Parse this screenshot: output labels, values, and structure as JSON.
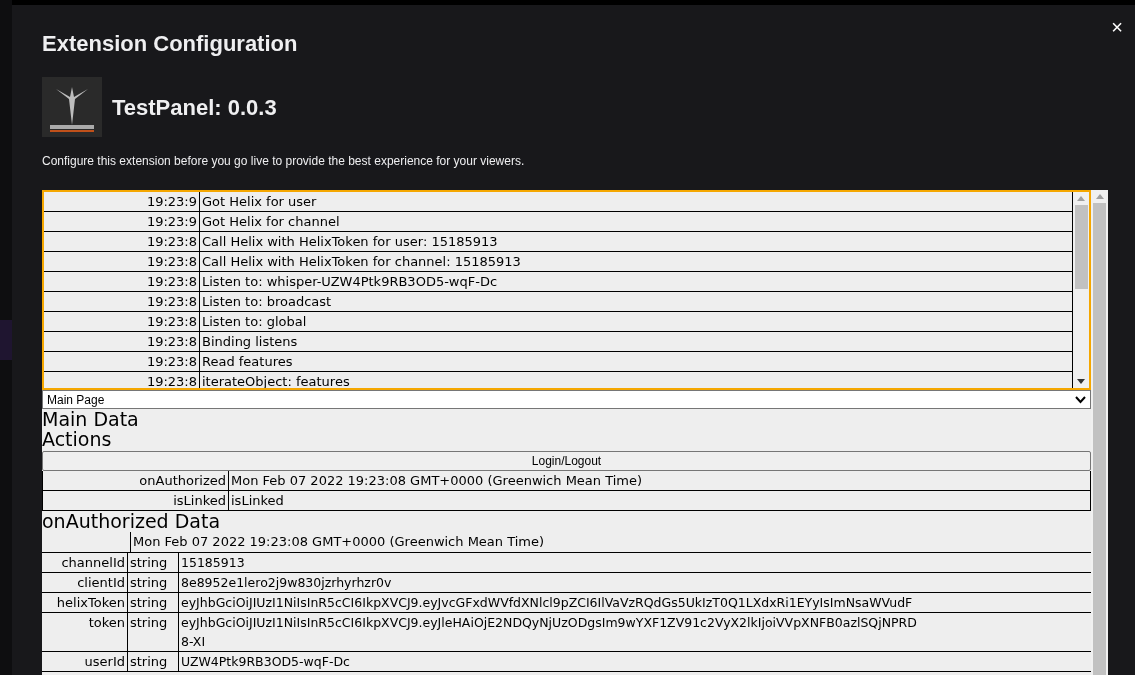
{
  "dialog": {
    "title": "Extension Configuration",
    "close_label": "×",
    "extension_name": "TestPanel: 0.0.3",
    "description": "Configure this extension before you go live to provide the best experience for your viewers."
  },
  "log": [
    {
      "time": "19:23:9",
      "message": "Got Helix for user"
    },
    {
      "time": "19:23:9",
      "message": "Got Helix for channel"
    },
    {
      "time": "19:23:8",
      "message": "Call Helix with HelixToken for user: 15185913"
    },
    {
      "time": "19:23:8",
      "message": "Call Helix with HelixToken for channel: 15185913"
    },
    {
      "time": "19:23:8",
      "message": "Listen to: whisper-UZW4Ptk9RB3OD5-wqF-Dc"
    },
    {
      "time": "19:23:8",
      "message": "Listen to: broadcast"
    },
    {
      "time": "19:23:8",
      "message": "Listen to: global"
    },
    {
      "time": "19:23:8",
      "message": "Binding listens"
    },
    {
      "time": "19:23:8",
      "message": "Read features"
    },
    {
      "time": "19:23:8",
      "message": "iterateObject: features"
    }
  ],
  "page_select": {
    "value": "Main Page"
  },
  "main_heading": "Main Data",
  "actions_heading": "Actions",
  "action_button": "Login/Logout",
  "status_rows": [
    {
      "label": "onAuthorized",
      "value": "Mon Feb 07 2022 19:23:08 GMT+0000 (Greenwich Mean Time)"
    },
    {
      "label": "isLinked",
      "value": "isLinked"
    }
  ],
  "auth_heading": "onAuthorized Data",
  "auth_timestamp": "Mon Feb 07 2022 19:23:08 GMT+0000 (Greenwich Mean Time)",
  "auth_rows": [
    {
      "key": "channelId",
      "type": "string",
      "value": "15185913"
    },
    {
      "key": "clientId",
      "type": "string",
      "value": "8e8952e1lero2j9w830jzrhyrhzr0v"
    },
    {
      "key": "helixToken",
      "type": "string",
      "value": "eyJhbGciOiJIUzI1NiIsInR5cCI6IkpXVCJ9.eyJvcGFxdWVfdXNlcl9pZCI6IlVaVzRQdGs5UkIzT0Q1LXdxRi1EYyIsImNsaWVudF"
    },
    {
      "key": "token",
      "type": "string",
      "value": "eyJhbGciOiJIUzI1NiIsInR5cCI6IkpXVCJ9.eyJleHAiOjE2NDQyNjUzODgsIm9wYXF1ZV91c2VyX2lkIjoiVVpXNFB0azlSQjNPRD\n8-XI"
    },
    {
      "key": "userId",
      "type": "string",
      "value": "UZW4Ptk9RB3OD5-wqF-Dc"
    }
  ]
}
